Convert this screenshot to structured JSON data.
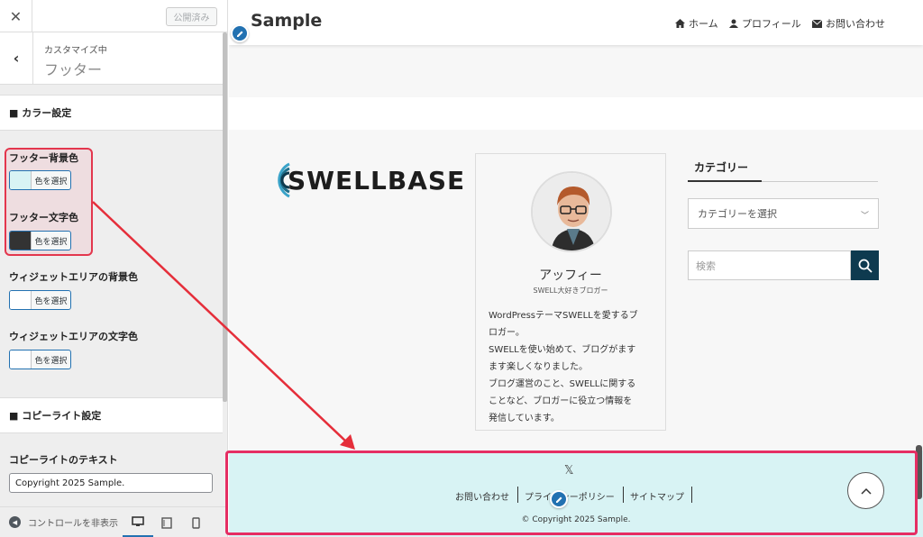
{
  "sidebar": {
    "publish_label": "公開済み",
    "heading_sub": "カスタマイズ中",
    "heading_title": "フッター",
    "section_color": "■ カラー設定",
    "footer_bg_label": "フッター背景色",
    "footer_text_label": "フッター文字色",
    "widget_bg_label": "ウィジェットエリアの背景色",
    "widget_text_label": "ウィジェットエリアの文字色",
    "choose_color": "色を選択",
    "section_copyright": "■ コピーライト設定",
    "copyright_text_label": "コピーライトのテキスト",
    "copyright_value": "Copyright 2025 Sample.",
    "hide_controls": "コントロールを非表示",
    "swatch_footer_bg": "#d8f3f4",
    "swatch_footer_text": "#333333",
    "swatch_widget_bg": "#ffffff",
    "swatch_widget_text": "#ffffff"
  },
  "preview": {
    "site_title": "Sample",
    "nav": [
      "ホーム",
      "プロフィール",
      "お問い合わせ"
    ],
    "logo_text": "SWELLBASE",
    "profile_name": "アッフィー",
    "profile_sub": "SWELL大好きブロガー",
    "profile_bio_lines": [
      "WordPressテーマSWELLを愛するブ",
      "ロガー。",
      "SWELLを使い始めて、ブログがます",
      "ます楽しくなりました。",
      "ブログ運営のこと、SWELLに関する",
      "ことなど、ブロガーに役立つ情報を",
      "発信しています。"
    ],
    "category_title": "カテゴリー",
    "category_select": "カテゴリーを選択",
    "search_placeholder": "検索",
    "footer_links": [
      "お問い合わせ",
      "プライバシーポリシー",
      "サイトマップ"
    ],
    "footer_copyright": "© Copyright 2025 Sample.",
    "accent_color": "#e52e63"
  }
}
